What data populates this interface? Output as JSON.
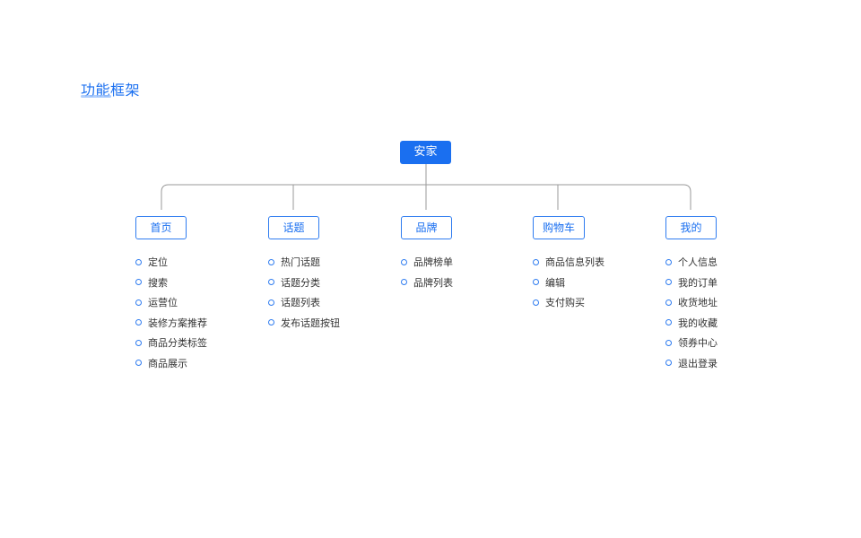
{
  "page": {
    "title": "功能框架"
  },
  "root": {
    "label": "安家"
  },
  "categories": [
    {
      "label": "首页",
      "items": [
        "定位",
        "搜索",
        "运营位",
        "装修方案推荐",
        "商品分类标签",
        "商品展示"
      ]
    },
    {
      "label": "话题",
      "items": [
        "热门话题",
        "话题分类",
        "话题列表",
        "发布话题按钮"
      ]
    },
    {
      "label": "品牌",
      "items": [
        "品牌榜单",
        "品牌列表"
      ]
    },
    {
      "label": "购物车",
      "items": [
        "商品信息列表",
        "编辑",
        "支付购买"
      ]
    },
    {
      "label": "我的",
      "items": [
        "个人信息",
        "我的订单",
        "收货地址",
        "我的收藏",
        "领券中心",
        "退出登录"
      ]
    }
  ],
  "colors": {
    "accent": "#1a6ff0",
    "connector": "#9a9a9a",
    "text": "#333333"
  }
}
